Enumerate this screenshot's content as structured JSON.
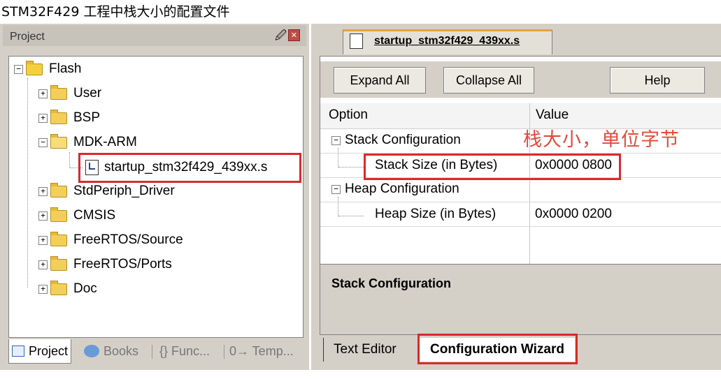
{
  "page_title": "STM32F429 工程中栈大小的配置文件",
  "project_panel": {
    "title": "Project",
    "pin_icon": "pin-icon",
    "close_icon": "close-icon",
    "tree": {
      "root": "Flash",
      "items": [
        {
          "label": "User",
          "expander": "+"
        },
        {
          "label": "BSP",
          "expander": "+"
        },
        {
          "label": "MDK-ARM",
          "expander": "−"
        },
        {
          "label": "startup_stm32f429_439xx.s",
          "expander": ""
        },
        {
          "label": "StdPeriph_Driver",
          "expander": "+"
        },
        {
          "label": "CMSIS",
          "expander": "+"
        },
        {
          "label": "FreeRTOS/Source",
          "expander": "+"
        },
        {
          "label": "FreeRTOS/Ports",
          "expander": "+"
        },
        {
          "label": "Doc",
          "expander": "+"
        }
      ],
      "root_expander": "−"
    },
    "bottom_tabs": [
      "Project",
      "Books",
      "{} Func...",
      "0→ Temp..."
    ]
  },
  "editor": {
    "file_tab": "startup_stm32f429_439xx.s",
    "buttons": {
      "expand_all": "Expand All",
      "collapse_all": "Collapse All",
      "help": "Help"
    },
    "grid": {
      "headers": {
        "option": "Option",
        "value": "Value"
      },
      "rows": [
        {
          "option": "Stack Configuration",
          "value": "",
          "expander": "−"
        },
        {
          "option": "Stack Size (in Bytes)",
          "value": "0x0000 0800",
          "expander": ""
        },
        {
          "option": "Heap Configuration",
          "value": "",
          "expander": "−"
        },
        {
          "option": "Heap Size (in Bytes)",
          "value": "0x0000 0200",
          "expander": ""
        }
      ]
    },
    "annotation": "栈大小，单位字节",
    "description": "Stack Configuration",
    "bottom_tabs": {
      "text_editor": "Text Editor",
      "config_wizard": "Configuration Wizard"
    }
  },
  "colors": {
    "highlight": "#d92a2a",
    "annotation": "#e24a3a",
    "tab_accent": "#e8a23a"
  }
}
